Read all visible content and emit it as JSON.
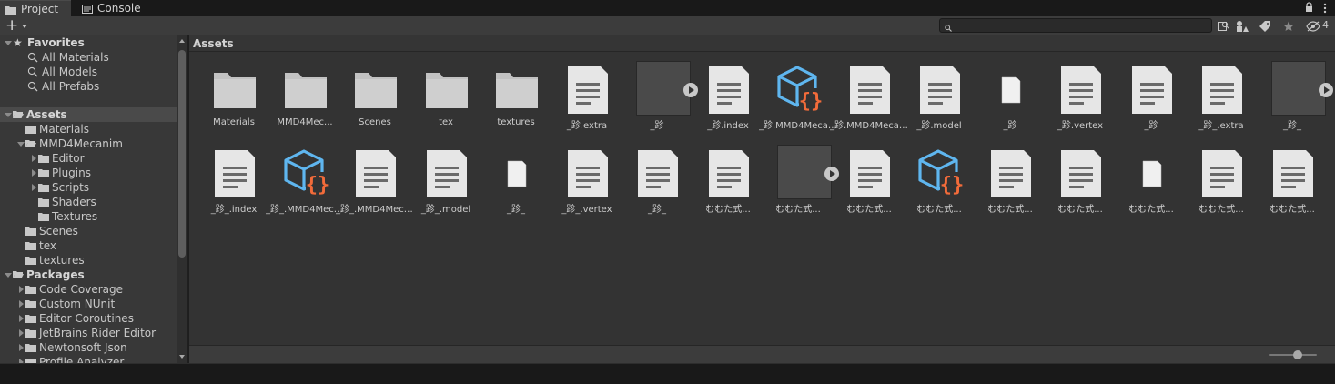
{
  "tabs": [
    {
      "label": "Project",
      "icon": "folder-icon",
      "active": true
    },
    {
      "label": "Console",
      "icon": "console-icon",
      "active": false
    }
  ],
  "toolbar": {
    "create_label": "+",
    "search": {
      "value": "",
      "placeholder": ""
    },
    "hidden_count": "4"
  },
  "sidebar": {
    "favorites": {
      "label": "Favorites",
      "items": [
        "All Materials",
        "All Models",
        "All Prefabs"
      ]
    },
    "assets": {
      "label": "Assets",
      "items": [
        {
          "label": "Materials",
          "indent": 1,
          "arrow": "none"
        },
        {
          "label": "MMD4Mecanim",
          "indent": 1,
          "arrow": "down"
        },
        {
          "label": "Editor",
          "indent": 2,
          "arrow": "right"
        },
        {
          "label": "Plugins",
          "indent": 2,
          "arrow": "right"
        },
        {
          "label": "Scripts",
          "indent": 2,
          "arrow": "right"
        },
        {
          "label": "Shaders",
          "indent": 2,
          "arrow": "none"
        },
        {
          "label": "Textures",
          "indent": 2,
          "arrow": "none"
        },
        {
          "label": "Scenes",
          "indent": 1,
          "arrow": "none"
        },
        {
          "label": "tex",
          "indent": 1,
          "arrow": "none"
        },
        {
          "label": "textures",
          "indent": 1,
          "arrow": "none"
        }
      ]
    },
    "packages": {
      "label": "Packages",
      "items": [
        "Code Coverage",
        "Custom NUnit",
        "Editor Coroutines",
        "JetBrains Rider Editor",
        "Newtonsoft Json",
        "Profile Analyzer"
      ]
    }
  },
  "main": {
    "breadcrumb": "Assets",
    "rows": [
      [
        {
          "label": "Materials",
          "kind": "folder"
        },
        {
          "label": "MMD4Mec...",
          "kind": "folder"
        },
        {
          "label": "Scenes",
          "kind": "folder"
        },
        {
          "label": "tex",
          "kind": "folder"
        },
        {
          "label": "textures",
          "kind": "folder"
        },
        {
          "label": "_跈.extra",
          "kind": "text"
        },
        {
          "label": "_跈",
          "kind": "model"
        },
        {
          "label": "_跈.index",
          "kind": "text"
        },
        {
          "label": "_跈.MMD4Mecanim",
          "kind": "script"
        },
        {
          "label": "_跈.MMD4Mecanim",
          "kind": "text"
        },
        {
          "label": "_跈.model",
          "kind": "text"
        },
        {
          "label": "_跈",
          "kind": "blank"
        },
        {
          "label": "_跈.vertex",
          "kind": "text"
        },
        {
          "label": "_跈",
          "kind": "text"
        },
        {
          "label": "_跈_.extra",
          "kind": "text"
        },
        {
          "label": "_跈_",
          "kind": "model"
        }
      ],
      [
        {
          "label": "_跈_.index",
          "kind": "text"
        },
        {
          "label": "_跈_.MMD4Meca...",
          "kind": "script"
        },
        {
          "label": "_跈_.MMD4Mecanim",
          "kind": "text"
        },
        {
          "label": "_跈_.model",
          "kind": "text"
        },
        {
          "label": "_跈_",
          "kind": "blank"
        },
        {
          "label": "_跈_.vertex",
          "kind": "text"
        },
        {
          "label": "_跈_",
          "kind": "text"
        },
        {
          "label": "むむた式...",
          "kind": "text"
        },
        {
          "label": "むむた式...",
          "kind": "model"
        },
        {
          "label": "むむた式...",
          "kind": "text"
        },
        {
          "label": "むむた式...",
          "kind": "script"
        },
        {
          "label": "むむた式...",
          "kind": "text"
        },
        {
          "label": "むむた式...",
          "kind": "text"
        },
        {
          "label": "むむた式...",
          "kind": "blank"
        },
        {
          "label": "むむた式...",
          "kind": "text"
        },
        {
          "label": "むむた式...",
          "kind": "text"
        }
      ]
    ]
  },
  "colors": {
    "panel": "#383838",
    "grid": "#333333",
    "folder": "#c2c2c2",
    "doc": "#e6e6e6",
    "script_cube": "#5fb6ef",
    "script_braces": "#f26b3a"
  }
}
